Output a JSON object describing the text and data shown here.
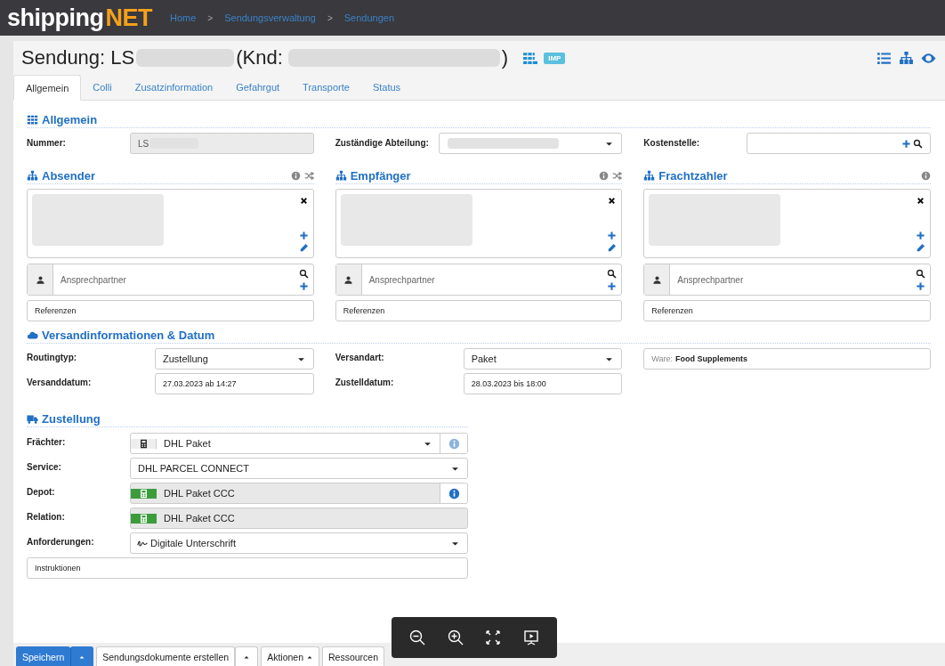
{
  "logo": {
    "left": "shipping",
    "right": "NET"
  },
  "breadcrumb": {
    "separator": ">",
    "items": [
      {
        "label": "Home"
      },
      {
        "label": "Sendungsverwaltung"
      },
      {
        "label": "Sendungen"
      }
    ]
  },
  "header": {
    "title_prefix": "Sendung: LS",
    "title_middle": "(Knd:",
    "title_suffix": ")",
    "badge": "IMP"
  },
  "tabs": [
    {
      "label": "Allgemein",
      "selected": true
    },
    {
      "label": "Colli",
      "selected": false
    },
    {
      "label": "Zusatzinformation",
      "selected": false
    },
    {
      "label": "Gefahrgut",
      "selected": false
    },
    {
      "label": "Transporte",
      "selected": false
    },
    {
      "label": "Status",
      "selected": false
    }
  ],
  "general": {
    "title": "Allgemein",
    "fields": [
      {
        "kind": "readonly",
        "label": "Nummer:",
        "value": "LS"
      },
      {
        "kind": "select",
        "label": "Zuständige Abteilung:"
      },
      {
        "kind": "lookup",
        "label": "Kostenstelle:"
      }
    ]
  },
  "parties": [
    {
      "title": "Absender",
      "info": true,
      "swap": true,
      "contact_placeholder": "Ansprechpartner",
      "references_placeholder": "Referenzen"
    },
    {
      "title": "Empfänger",
      "info": true,
      "swap": true,
      "contact_placeholder": "Ansprechpartner",
      "references_placeholder": "Referenzen"
    },
    {
      "title": "Frachtzahler",
      "info": true,
      "swap": false,
      "contact_placeholder": "Ansprechpartner",
      "references_placeholder": "Referenzen"
    }
  ],
  "shipping": {
    "title": "Versandinformationen & Datum",
    "routing": {
      "label": "Routingtyp:",
      "value": "Zustellung"
    },
    "mode": {
      "label": "Versandart:",
      "value": "Paket"
    },
    "goods": {
      "prefix": "Ware:",
      "value": "Food Supplements"
    },
    "ship_date": {
      "label": "Versanddatum:",
      "value": "27.03.2023 ab 14:27"
    },
    "delivery_date": {
      "label": "Zustelldatum:",
      "value": "28.03.2023 bis 18:00"
    }
  },
  "delivery": {
    "title": "Zustellung",
    "rows": [
      {
        "kind": "carrier",
        "label": "Frächter:",
        "value": "DHL Paket",
        "info": {
          "active": false
        }
      },
      {
        "kind": "select",
        "label": "Service:",
        "value": "DHL PARCEL CONNECT"
      },
      {
        "kind": "assigned",
        "label": "Depot:",
        "value": "DHL Paket CCC",
        "info": {
          "active": true
        }
      },
      {
        "kind": "assigned",
        "label": "Relation:",
        "value": "DHL Paket CCC"
      },
      {
        "kind": "requirement",
        "label": "Anforderungen:",
        "value": "Digitale Unterschrift"
      }
    ],
    "instructions_placeholder": "Instruktionen"
  },
  "footer": [
    {
      "kind": "split-primary",
      "label": "Speichern"
    },
    {
      "kind": "split",
      "label": "Sendungsdokumente erstellen"
    },
    {
      "kind": "dropup",
      "label": "Aktionen"
    },
    {
      "kind": "plain",
      "label": "Ressourcen"
    }
  ]
}
